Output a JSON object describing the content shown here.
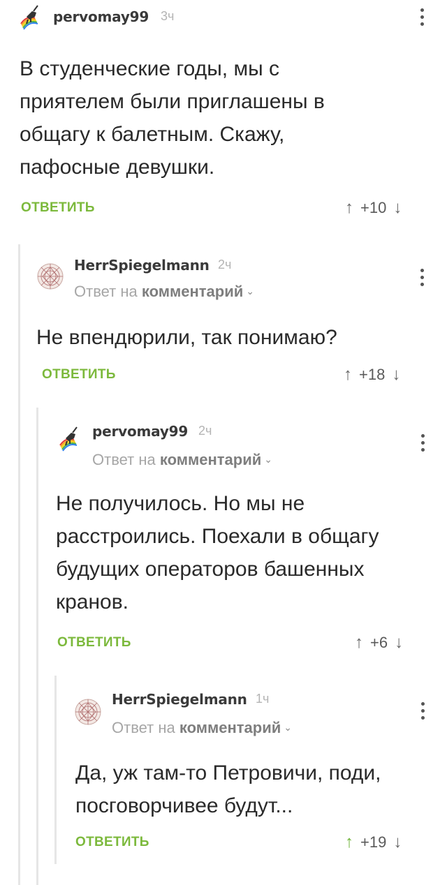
{
  "comments": [
    {
      "username": "pervomay99",
      "time": "3ч",
      "text": "В студенческие годы, мы с приятелем были приглашены в общагу к балетным. Скажу, пафосные девушки.",
      "reply_label": "ОТВЕТИТЬ",
      "score": "+10",
      "avatar": "unicorn-rainbow-icon"
    },
    {
      "username": "HerrSpiegelmann",
      "time": "2ч",
      "reply_to_prefix": "Ответ на",
      "reply_to_link": "комментарий",
      "text": "Не впендюрили, так понимаю?",
      "reply_label": "ОТВЕТИТЬ",
      "score": "+18",
      "avatar": "mandala-sphere-icon"
    },
    {
      "username": "pervomay99",
      "time": "2ч",
      "reply_to_prefix": "Ответ на",
      "reply_to_link": "комментарий",
      "text": "Не получилось. Но мы не расстроились. Поехали в общагу будущих операторов башенных кранов.",
      "reply_label": "ОТВЕТИТЬ",
      "score": "+6",
      "avatar": "unicorn-rainbow-icon"
    },
    {
      "username": "HerrSpiegelmann",
      "time": "1ч",
      "reply_to_prefix": "Ответ на",
      "reply_to_link": "комментарий",
      "text": "Да, уж там-то Петровичи, поди, посговорчивее будут...",
      "reply_label": "ОТВЕТИТЬ",
      "score": "+19",
      "upvoted": true,
      "avatar": "mandala-sphere-icon"
    }
  ],
  "colors": {
    "accent": "#7cb93c",
    "thread_line": "#e6e6e6",
    "muted": "#a6a6a6"
  }
}
